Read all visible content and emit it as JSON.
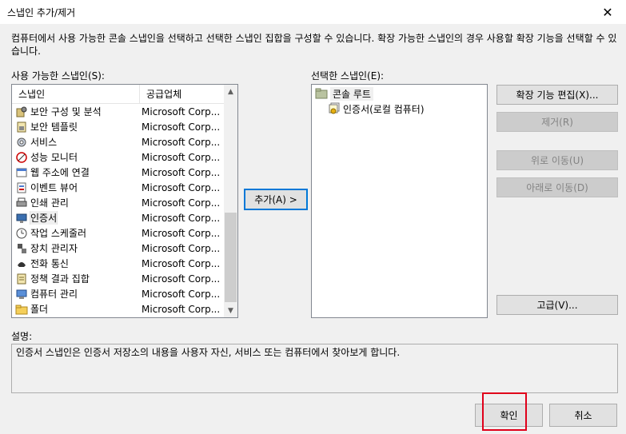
{
  "window": {
    "title": "스냅인 추가/제거",
    "close_glyph": "✕"
  },
  "intro_text": "컴퓨터에서 사용 가능한 콘솔 스냅인을 선택하고 선택한 스냅인 집합을 구성할 수 있습니다. 확장 가능한 스냅인의 경우 사용할 확장 기능을 선택할 수 있습니다.",
  "available": {
    "label": "사용 가능한 스냅인(S):",
    "col_snapin": "스냅인",
    "col_vendor": "공급업체",
    "items": [
      {
        "name": "보안 구성 및 분석",
        "vendor": "Microsoft Corp...",
        "icon": "security-analysis-icon"
      },
      {
        "name": "보안 템플릿",
        "vendor": "Microsoft Corp...",
        "icon": "security-template-icon"
      },
      {
        "name": "서비스",
        "vendor": "Microsoft Corp...",
        "icon": "services-gear-icon"
      },
      {
        "name": "성능 모니터",
        "vendor": "Microsoft Corp...",
        "icon": "performance-monitor-icon"
      },
      {
        "name": "웹 주소에 연결",
        "vendor": "Microsoft Corp...",
        "icon": "web-link-icon"
      },
      {
        "name": "이벤트 뷰어",
        "vendor": "Microsoft Corp...",
        "icon": "event-viewer-icon"
      },
      {
        "name": "인쇄 관리",
        "vendor": "Microsoft Corp...",
        "icon": "print-management-icon"
      },
      {
        "name": "인증서",
        "vendor": "Microsoft Corp...",
        "icon": "certificates-icon"
      },
      {
        "name": "작업 스케줄러",
        "vendor": "Microsoft Corp...",
        "icon": "task-scheduler-clock-icon"
      },
      {
        "name": "장치 관리자",
        "vendor": "Microsoft Corp...",
        "icon": "device-manager-icon"
      },
      {
        "name": "전화 통신",
        "vendor": "Microsoft Corp...",
        "icon": "telephony-icon"
      },
      {
        "name": "정책 결과 집합",
        "vendor": "Microsoft Corp...",
        "icon": "policy-result-icon"
      },
      {
        "name": "컴퓨터 관리",
        "vendor": "Microsoft Corp...",
        "icon": "computer-management-icon"
      },
      {
        "name": "폴더",
        "vendor": "Microsoft Corp...",
        "icon": "folder-icon"
      }
    ]
  },
  "add_button": "추가(A) >",
  "selected": {
    "label": "선택한 스냅인(E):",
    "root": "콘솔 루트",
    "child": "인증서(로컬 컴퓨터)"
  },
  "buttons": {
    "edit_ext": "확장 기능 편집(X)...",
    "remove": "제거(R)",
    "move_up": "위로 이동(U)",
    "move_down": "아래로 이동(D)",
    "advanced": "고급(V)...",
    "ok": "확인",
    "cancel": "취소"
  },
  "description": {
    "label": "설명:",
    "text": "인증서 스냅인은 인증서 저장소의 내용을 사용자 자신, 서비스 또는 컴퓨터에서 찾아보게 합니다."
  },
  "colors": {
    "accent": "#0078d7",
    "highlight_box": "#e0001a"
  }
}
